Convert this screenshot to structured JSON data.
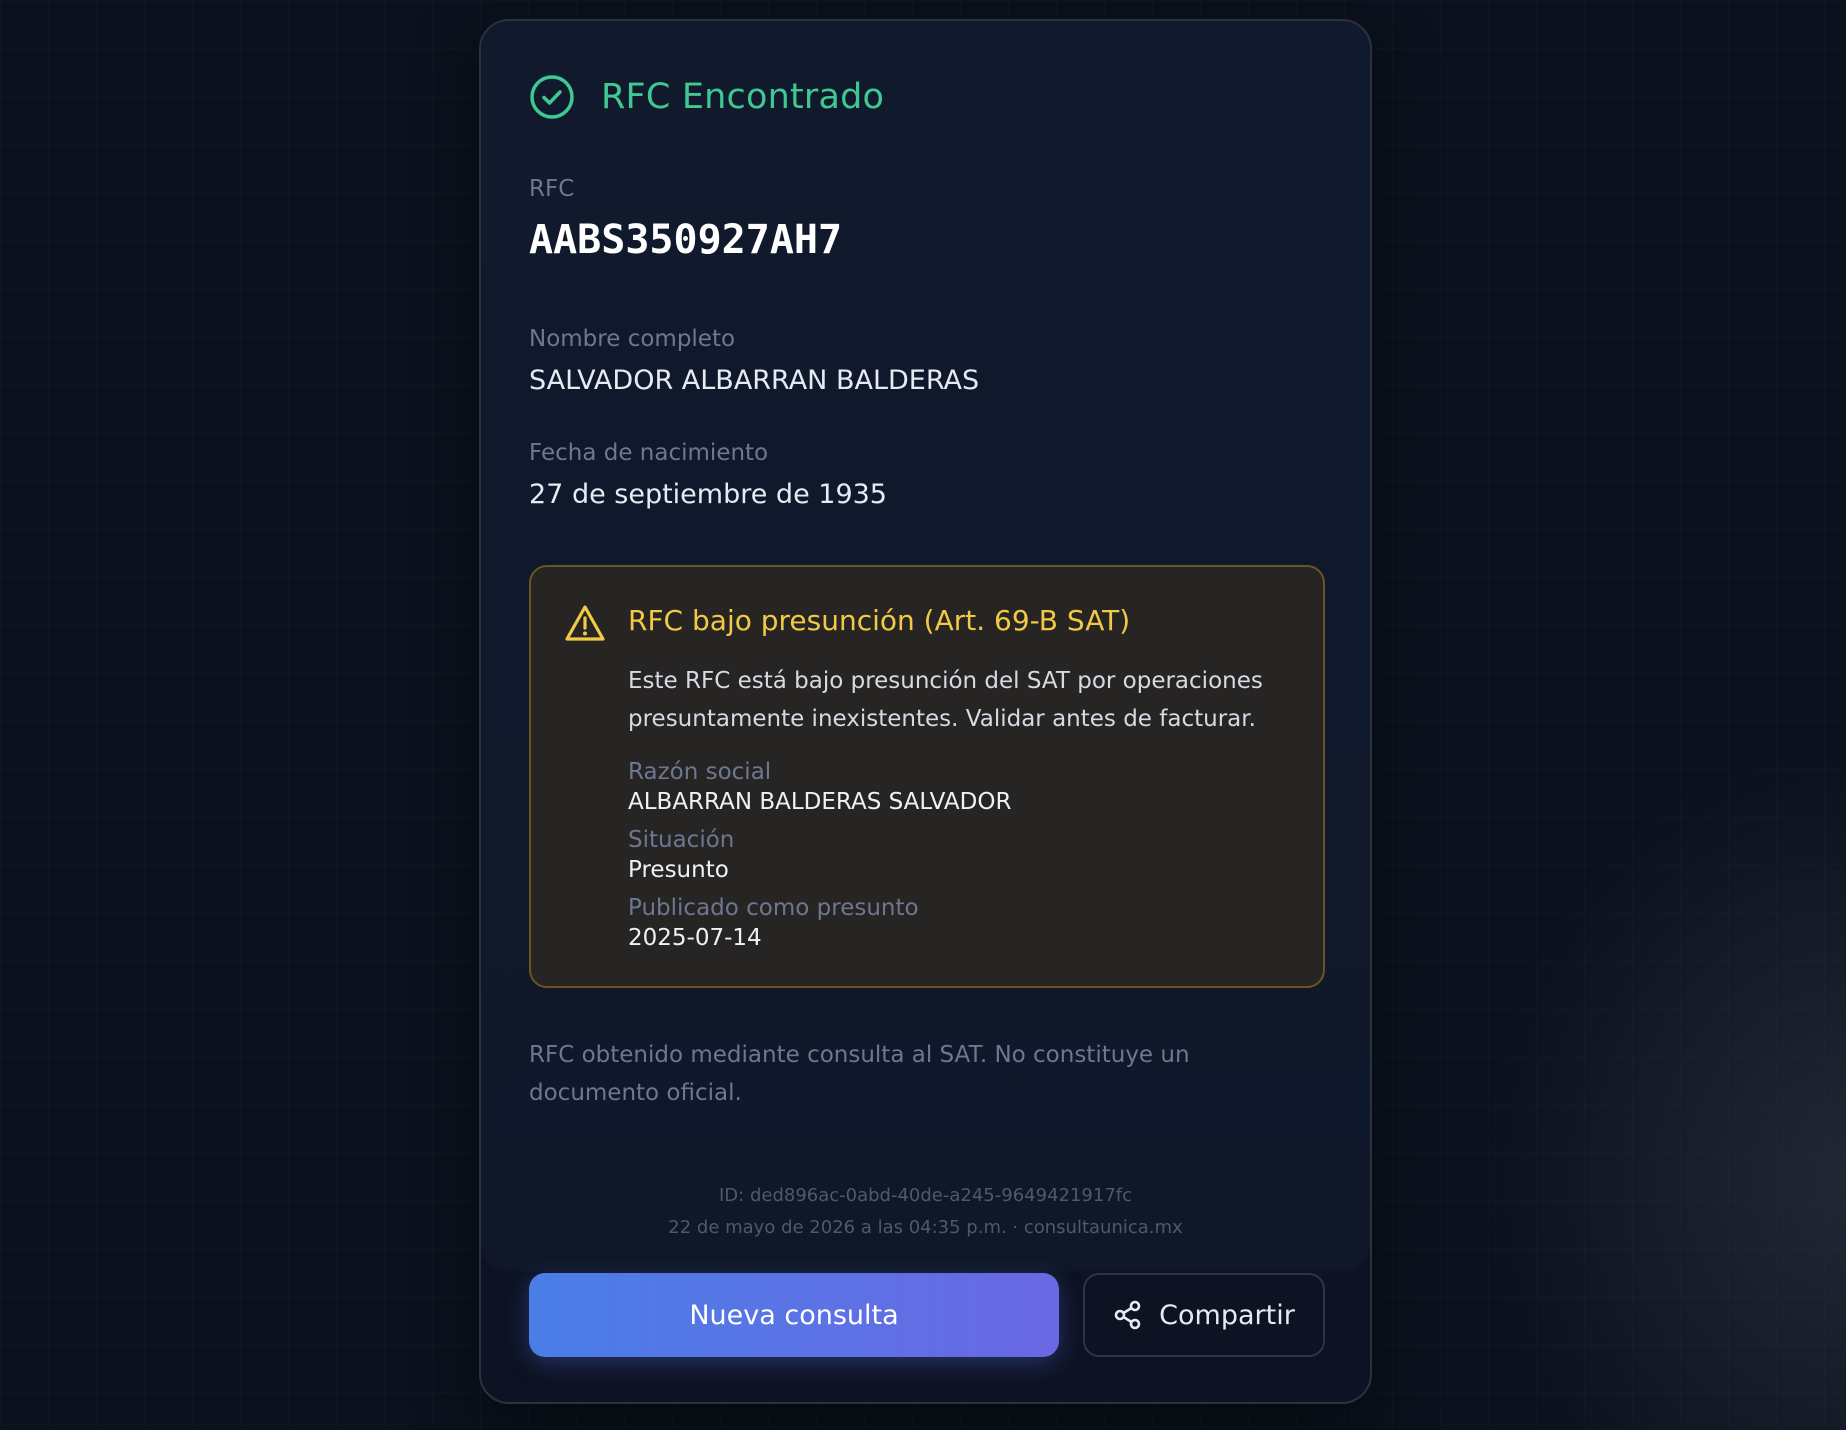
{
  "header": {
    "title": "RFC Encontrado",
    "icon": "check-circle-icon",
    "color": "#3ec992"
  },
  "fields": {
    "rfc_label": "RFC",
    "rfc_value": "AABS350927AH7",
    "name_label": "Nombre completo",
    "name_value": "SALVADOR ALBARRAN BALDERAS",
    "birth_label": "Fecha de nacimiento",
    "birth_value": "27 de septiembre de 1935"
  },
  "alert": {
    "icon": "warning-icon",
    "color": "#f2c945",
    "title": "RFC bajo presunción (Art. 69-B SAT)",
    "description": "Este RFC está bajo presunción del SAT por operaciones presuntamente inexistentes. Validar antes de facturar.",
    "razon_label": "Razón social",
    "razon_value": "ALBARRAN BALDERAS SALVADOR",
    "situacion_label": "Situación",
    "situacion_value": "Presunto",
    "publicado_label": "Publicado como presunto",
    "publicado_value": "2025-07-14"
  },
  "disclaimer": "RFC obtenido mediante consulta al SAT. No constituye un documento oficial.",
  "meta": {
    "id": "ID: ded896ac-0abd-40de-a245-9649421917fc",
    "timestamp": "22 de mayo de 2026 a las 04:35 p.m. · consultaunica.mx"
  },
  "actions": {
    "new_query_label": "Nueva consulta",
    "share_label": "Compartir",
    "share_icon": "share-icon"
  }
}
